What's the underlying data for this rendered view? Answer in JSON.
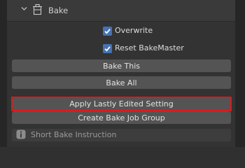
{
  "panel": {
    "title": "Bake",
    "icons": {
      "expand": "chevron-down-icon",
      "panel": "bake-bucket-icon"
    }
  },
  "options": {
    "overwrite": {
      "label": "Overwrite",
      "checked": true
    },
    "reset_bakemaster": {
      "label": "Reset BakeMaster",
      "checked": true
    }
  },
  "buttons": {
    "bake_this": "Bake This",
    "bake_all": "Bake All",
    "apply_lastly_edited": "Apply Lastly Edited Setting",
    "create_bake_job_group": "Create Bake Job Group"
  },
  "info": {
    "label": "Short Bake Instruction",
    "icon": "info-icon"
  },
  "colors": {
    "checkbox": "#4772b3",
    "highlight": "#e0191b",
    "button": "#545454"
  }
}
